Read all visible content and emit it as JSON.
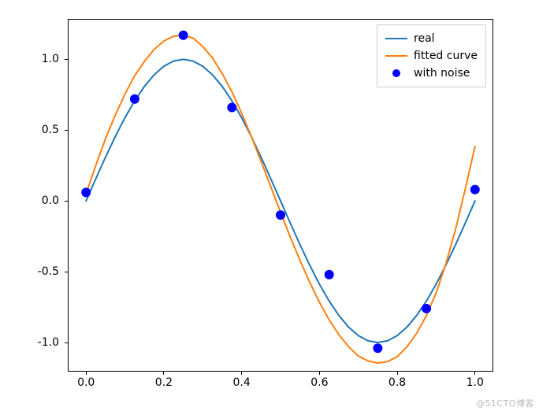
{
  "chart_data": {
    "type": "line",
    "xlim": [
      -0.045,
      1.045
    ],
    "ylim": [
      -1.2,
      1.28
    ],
    "xticks": [
      0.0,
      0.2,
      0.4,
      0.6,
      0.8,
      1.0
    ],
    "yticks": [
      -1.0,
      -0.5,
      0.0,
      0.5,
      1.0
    ],
    "xtick_labels": [
      "0.0",
      "0.2",
      "0.4",
      "0.6",
      "0.8",
      "1.0"
    ],
    "ytick_labels": [
      "-1.0",
      "-0.5",
      "0.0",
      "0.5",
      "1.0"
    ],
    "series": [
      {
        "name": "real",
        "type": "line",
        "color": "#1f77b4",
        "x": [
          0.0,
          0.025,
          0.05,
          0.075,
          0.1,
          0.125,
          0.15,
          0.175,
          0.2,
          0.225,
          0.25,
          0.275,
          0.3,
          0.325,
          0.35,
          0.375,
          0.4,
          0.425,
          0.45,
          0.475,
          0.5,
          0.525,
          0.55,
          0.575,
          0.6,
          0.625,
          0.65,
          0.675,
          0.7,
          0.725,
          0.75,
          0.775,
          0.8,
          0.825,
          0.85,
          0.875,
          0.9,
          0.925,
          0.95,
          0.975,
          1.0
        ],
        "y": [
          0.0,
          0.156,
          0.309,
          0.454,
          0.588,
          0.707,
          0.809,
          0.891,
          0.951,
          0.988,
          1.0,
          0.988,
          0.951,
          0.891,
          0.809,
          0.707,
          0.588,
          0.454,
          0.309,
          0.156,
          0.0,
          -0.156,
          -0.309,
          -0.454,
          -0.588,
          -0.707,
          -0.809,
          -0.891,
          -0.951,
          -0.988,
          -1.0,
          -0.988,
          -0.951,
          -0.891,
          -0.809,
          -0.707,
          -0.588,
          -0.454,
          -0.309,
          -0.156,
          0.0
        ]
      },
      {
        "name": "fitted curve",
        "type": "line",
        "color": "#ff7f0e",
        "x": [
          0.0,
          0.025,
          0.05,
          0.075,
          0.1,
          0.125,
          0.15,
          0.175,
          0.2,
          0.225,
          0.25,
          0.275,
          0.3,
          0.325,
          0.35,
          0.375,
          0.4,
          0.425,
          0.45,
          0.475,
          0.5,
          0.525,
          0.55,
          0.575,
          0.6,
          0.625,
          0.65,
          0.675,
          0.7,
          0.725,
          0.75,
          0.775,
          0.8,
          0.825,
          0.85,
          0.875,
          0.9,
          0.925,
          0.95,
          0.975,
          1.0
        ],
        "y": [
          0.05,
          0.25,
          0.44,
          0.605,
          0.755,
          0.885,
          0.985,
          1.07,
          1.13,
          1.163,
          1.17,
          1.15,
          1.09,
          1.01,
          0.9,
          0.77,
          0.62,
          0.455,
          0.28,
          0.1,
          -0.08,
          -0.255,
          -0.42,
          -0.575,
          -0.715,
          -0.84,
          -0.945,
          -1.03,
          -1.095,
          -1.13,
          -1.145,
          -1.135,
          -1.1,
          -1.03,
          -0.935,
          -0.81,
          -0.65,
          -0.445,
          -0.2,
          0.085,
          0.385
        ]
      },
      {
        "name": "with noise",
        "type": "scatter",
        "color": "#0000ff",
        "x": [
          0.0,
          0.125,
          0.25,
          0.375,
          0.5,
          0.625,
          0.75,
          0.875,
          1.0
        ],
        "y": [
          0.06,
          0.72,
          1.17,
          0.66,
          -0.1,
          -0.52,
          -1.04,
          -0.76,
          0.08
        ]
      }
    ],
    "legend": {
      "entries": [
        "real",
        "fitted curve",
        "with noise"
      ]
    },
    "title": "",
    "xlabel": "",
    "ylabel": ""
  },
  "watermark": "@51CTO博客"
}
